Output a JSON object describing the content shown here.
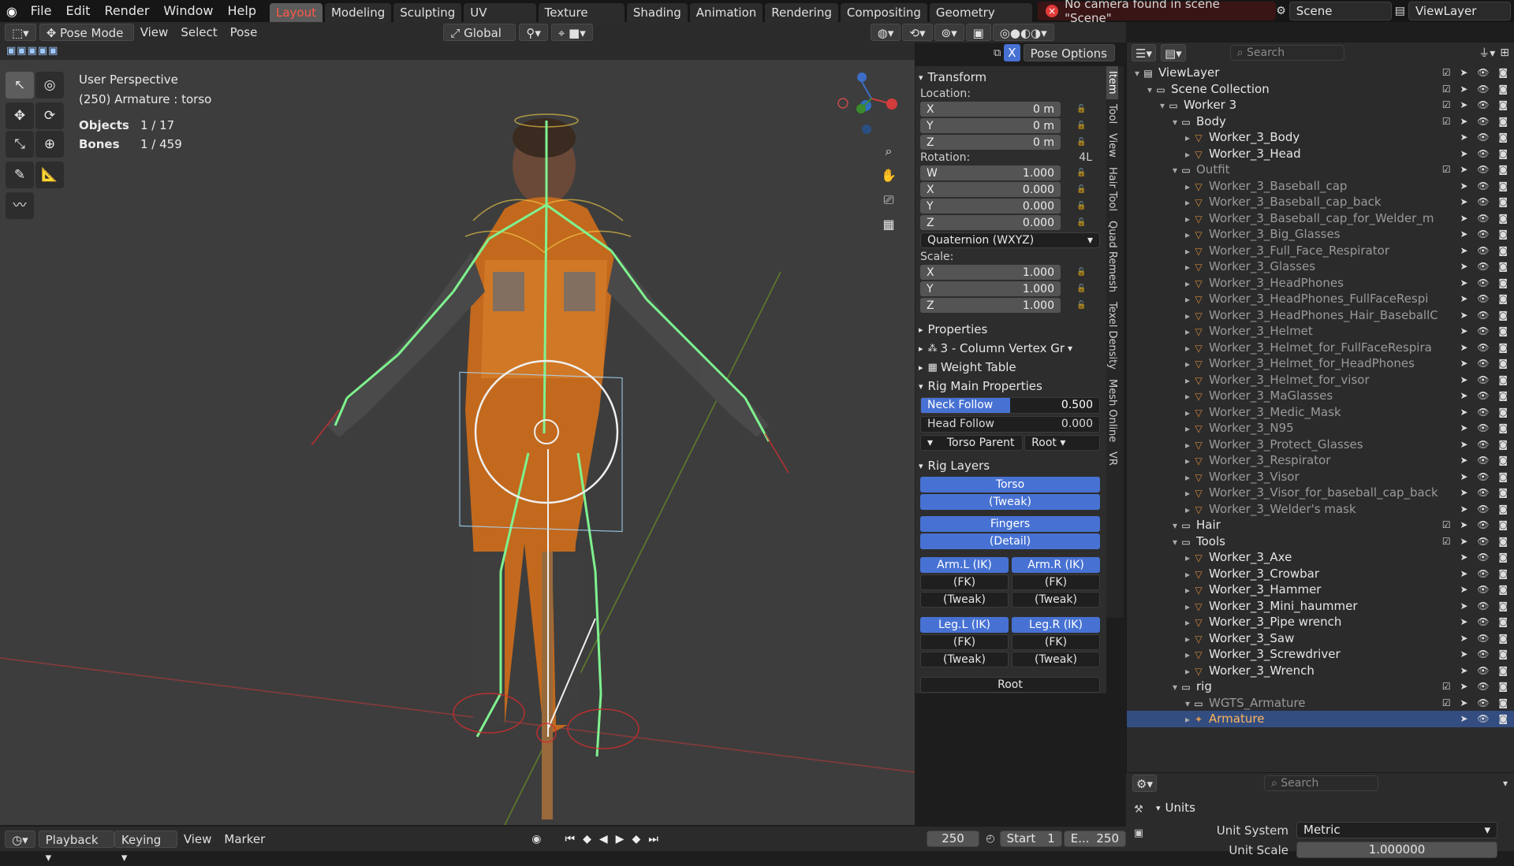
{
  "app": {
    "logo_icon": "blender-logo-icon"
  },
  "menu": [
    "File",
    "Edit",
    "Render",
    "Window",
    "Help"
  ],
  "workspaces": [
    "Layout",
    "Modeling",
    "Sculpting",
    "UV Editing",
    "Texture Paint",
    "Shading",
    "Animation",
    "Rendering",
    "Compositing",
    "Geometry Node"
  ],
  "active_workspace": "Layout",
  "warning": "No camera found in scene \"Scene\"",
  "scene": "Scene",
  "view_layer": "ViewLayer",
  "header": {
    "mode": "Pose Mode",
    "menus": [
      "View",
      "Select",
      "Pose"
    ],
    "orientation": "Global",
    "pose_options": "Pose Options",
    "x_mirror": "X"
  },
  "viewport": {
    "perspective": "User Perspective",
    "context": "(250) Armature : torso",
    "objects_label": "Objects",
    "objects_value": "1 / 17",
    "bones_label": "Bones",
    "bones_value": "1 / 459",
    "grid_floor": "#454545",
    "axis_x_color": "#b04545",
    "axis_y_color": "#7a9a3a",
    "bone_color": "#7ff28f",
    "gizmo": {
      "x": "X",
      "y": "Y",
      "z": "Z"
    }
  },
  "npanel": {
    "transform": "Transform",
    "location_label": "Location:",
    "location": [
      {
        "axis": "X",
        "value": "0 m"
      },
      {
        "axis": "Y",
        "value": "0 m"
      },
      {
        "axis": "Z",
        "value": "0 m"
      }
    ],
    "rotation_label": "Rotation:",
    "rotation_mode_short": "4L",
    "rotation": [
      {
        "axis": "W",
        "value": "1.000"
      },
      {
        "axis": "X",
        "value": "0.000"
      },
      {
        "axis": "Y",
        "value": "0.000"
      },
      {
        "axis": "Z",
        "value": "0.000"
      }
    ],
    "rotation_mode": "Quaternion (WXYZ)",
    "scale_label": "Scale:",
    "scale": [
      {
        "axis": "X",
        "value": "1.000"
      },
      {
        "axis": "Y",
        "value": "1.000"
      },
      {
        "axis": "Z",
        "value": "1.000"
      }
    ],
    "properties": "Properties",
    "vertex_group": "3 - Column Vertex Gr",
    "weight_table": "Weight Table",
    "rig_main": "Rig Main Properties",
    "neck_follow_label": "Neck Follow",
    "neck_follow": "0.500",
    "neck_follow_fraction": 0.5,
    "head_follow_label": "Head Follow",
    "head_follow": "0.000",
    "torso_parent_label": "Torso Parent",
    "torso_parent": "Root",
    "rig_layers": "Rig Layers",
    "layers": {
      "torso": "Torso",
      "torso_tweak": "(Tweak)",
      "fingers": "Fingers",
      "fingers_detail": "(Detail)",
      "arm_l_ik": "Arm.L (IK)",
      "arm_r_ik": "Arm.R (IK)",
      "arm_l_fk": "(FK)",
      "arm_r_fk": "(FK)",
      "arm_l_tweak": "(Tweak)",
      "arm_r_tweak": "(Tweak)",
      "leg_l_ik": "Leg.L (IK)",
      "leg_r_ik": "Leg.R (IK)",
      "leg_l_fk": "(FK)",
      "leg_r_fk": "(FK)",
      "leg_l_tweak": "(Tweak)",
      "leg_r_tweak": "(Tweak)",
      "root": "Root"
    }
  },
  "side_tabs": [
    "Item",
    "Tool",
    "View",
    "Hair Tool",
    "Quad Remesh",
    "Texel Density",
    "Mesh Online",
    "VR"
  ],
  "outliner": {
    "search_placeholder": "Search",
    "rows": [
      {
        "name": "ViewLayer",
        "type": "layer",
        "indent": 0
      },
      {
        "name": "Scene Collection",
        "type": "collection",
        "indent": 1
      },
      {
        "name": "Worker 3",
        "type": "collection",
        "indent": 2
      },
      {
        "name": "Body",
        "type": "collection",
        "indent": 3
      },
      {
        "name": "Worker_3_Body",
        "type": "mesh",
        "indent": 4
      },
      {
        "name": "Worker_3_Head",
        "type": "mesh",
        "indent": 4
      },
      {
        "name": "Outfit",
        "type": "collection",
        "indent": 3,
        "dim": true
      },
      {
        "name": "Worker_3_Baseball_cap",
        "type": "mesh",
        "indent": 4,
        "dim": true
      },
      {
        "name": "Worker_3_Baseball_cap_back",
        "type": "mesh",
        "indent": 4,
        "dim": true
      },
      {
        "name": "Worker_3_Baseball_cap_for_Welder_m",
        "type": "mesh",
        "indent": 4,
        "dim": true
      },
      {
        "name": "Worker_3_Big_Glasses",
        "type": "mesh",
        "indent": 4,
        "dim": true
      },
      {
        "name": "Worker_3_Full_Face_Respirator",
        "type": "mesh",
        "indent": 4,
        "dim": true
      },
      {
        "name": "Worker_3_Glasses",
        "type": "mesh",
        "indent": 4,
        "dim": true
      },
      {
        "name": "Worker_3_HeadPhones",
        "type": "mesh",
        "indent": 4,
        "dim": true
      },
      {
        "name": "Worker_3_HeadPhones_FullFaceRespi",
        "type": "mesh",
        "indent": 4,
        "dim": true
      },
      {
        "name": "Worker_3_HeadPhones_Hair_BaseballC",
        "type": "mesh",
        "indent": 4,
        "dim": true
      },
      {
        "name": "Worker_3_Helmet",
        "type": "mesh",
        "indent": 4,
        "dim": true
      },
      {
        "name": "Worker_3_Helmet_for_FullFaceRespira",
        "type": "mesh",
        "indent": 4,
        "dim": true
      },
      {
        "name": "Worker_3_Helmet_for_HeadPhones",
        "type": "mesh",
        "indent": 4,
        "dim": true
      },
      {
        "name": "Worker_3_Helmet_for_visor",
        "type": "mesh",
        "indent": 4,
        "dim": true
      },
      {
        "name": "Worker_3_MaGlasses",
        "type": "mesh",
        "indent": 4,
        "dim": true
      },
      {
        "name": "Worker_3_Medic_Mask",
        "type": "mesh",
        "indent": 4,
        "dim": true
      },
      {
        "name": "Worker_3_N95",
        "type": "mesh",
        "indent": 4,
        "dim": true
      },
      {
        "name": "Worker_3_Protect_Glasses",
        "type": "mesh",
        "indent": 4,
        "dim": true
      },
      {
        "name": "Worker_3_Respirator",
        "type": "mesh",
        "indent": 4,
        "dim": true
      },
      {
        "name": "Worker_3_Visor",
        "type": "mesh",
        "indent": 4,
        "dim": true
      },
      {
        "name": "Worker_3_Visor_for_baseball_cap_back",
        "type": "mesh",
        "indent": 4,
        "dim": true
      },
      {
        "name": "Worker_3_Welder's mask",
        "type": "mesh",
        "indent": 4,
        "dim": true
      },
      {
        "name": "Hair",
        "type": "collection",
        "indent": 3
      },
      {
        "name": "Tools",
        "type": "collection",
        "indent": 3
      },
      {
        "name": "Worker_3_Axe",
        "type": "mesh",
        "indent": 4
      },
      {
        "name": "Worker_3_Crowbar",
        "type": "mesh",
        "indent": 4
      },
      {
        "name": "Worker_3_Hammer",
        "type": "mesh",
        "indent": 4
      },
      {
        "name": "Worker_3_Mini_haummer",
        "type": "mesh",
        "indent": 4
      },
      {
        "name": "Worker_3_Pipe wrench",
        "type": "mesh",
        "indent": 4
      },
      {
        "name": "Worker_3_Saw",
        "type": "mesh",
        "indent": 4
      },
      {
        "name": "Worker_3_Screwdriver",
        "type": "mesh",
        "indent": 4
      },
      {
        "name": "Worker_3_Wrench",
        "type": "mesh",
        "indent": 4
      },
      {
        "name": "rig",
        "type": "collection",
        "indent": 3
      },
      {
        "name": "WGTS_Armature",
        "type": "collection",
        "indent": 4,
        "dim": true
      },
      {
        "name": "Armature",
        "type": "armature",
        "indent": 4,
        "selected": true
      }
    ]
  },
  "properties": {
    "search_placeholder": "Search",
    "units": "Units",
    "unit_system_label": "Unit System",
    "unit_system": "Metric",
    "unit_scale_label": "Unit Scale",
    "unit_scale": "1.000000"
  },
  "timeline": {
    "playback": "Playback",
    "keying": "Keying",
    "view": "View",
    "marker": "Marker",
    "current_frame": "250",
    "start_label": "Start",
    "start": "1",
    "end_label": "E...",
    "end": "250"
  }
}
